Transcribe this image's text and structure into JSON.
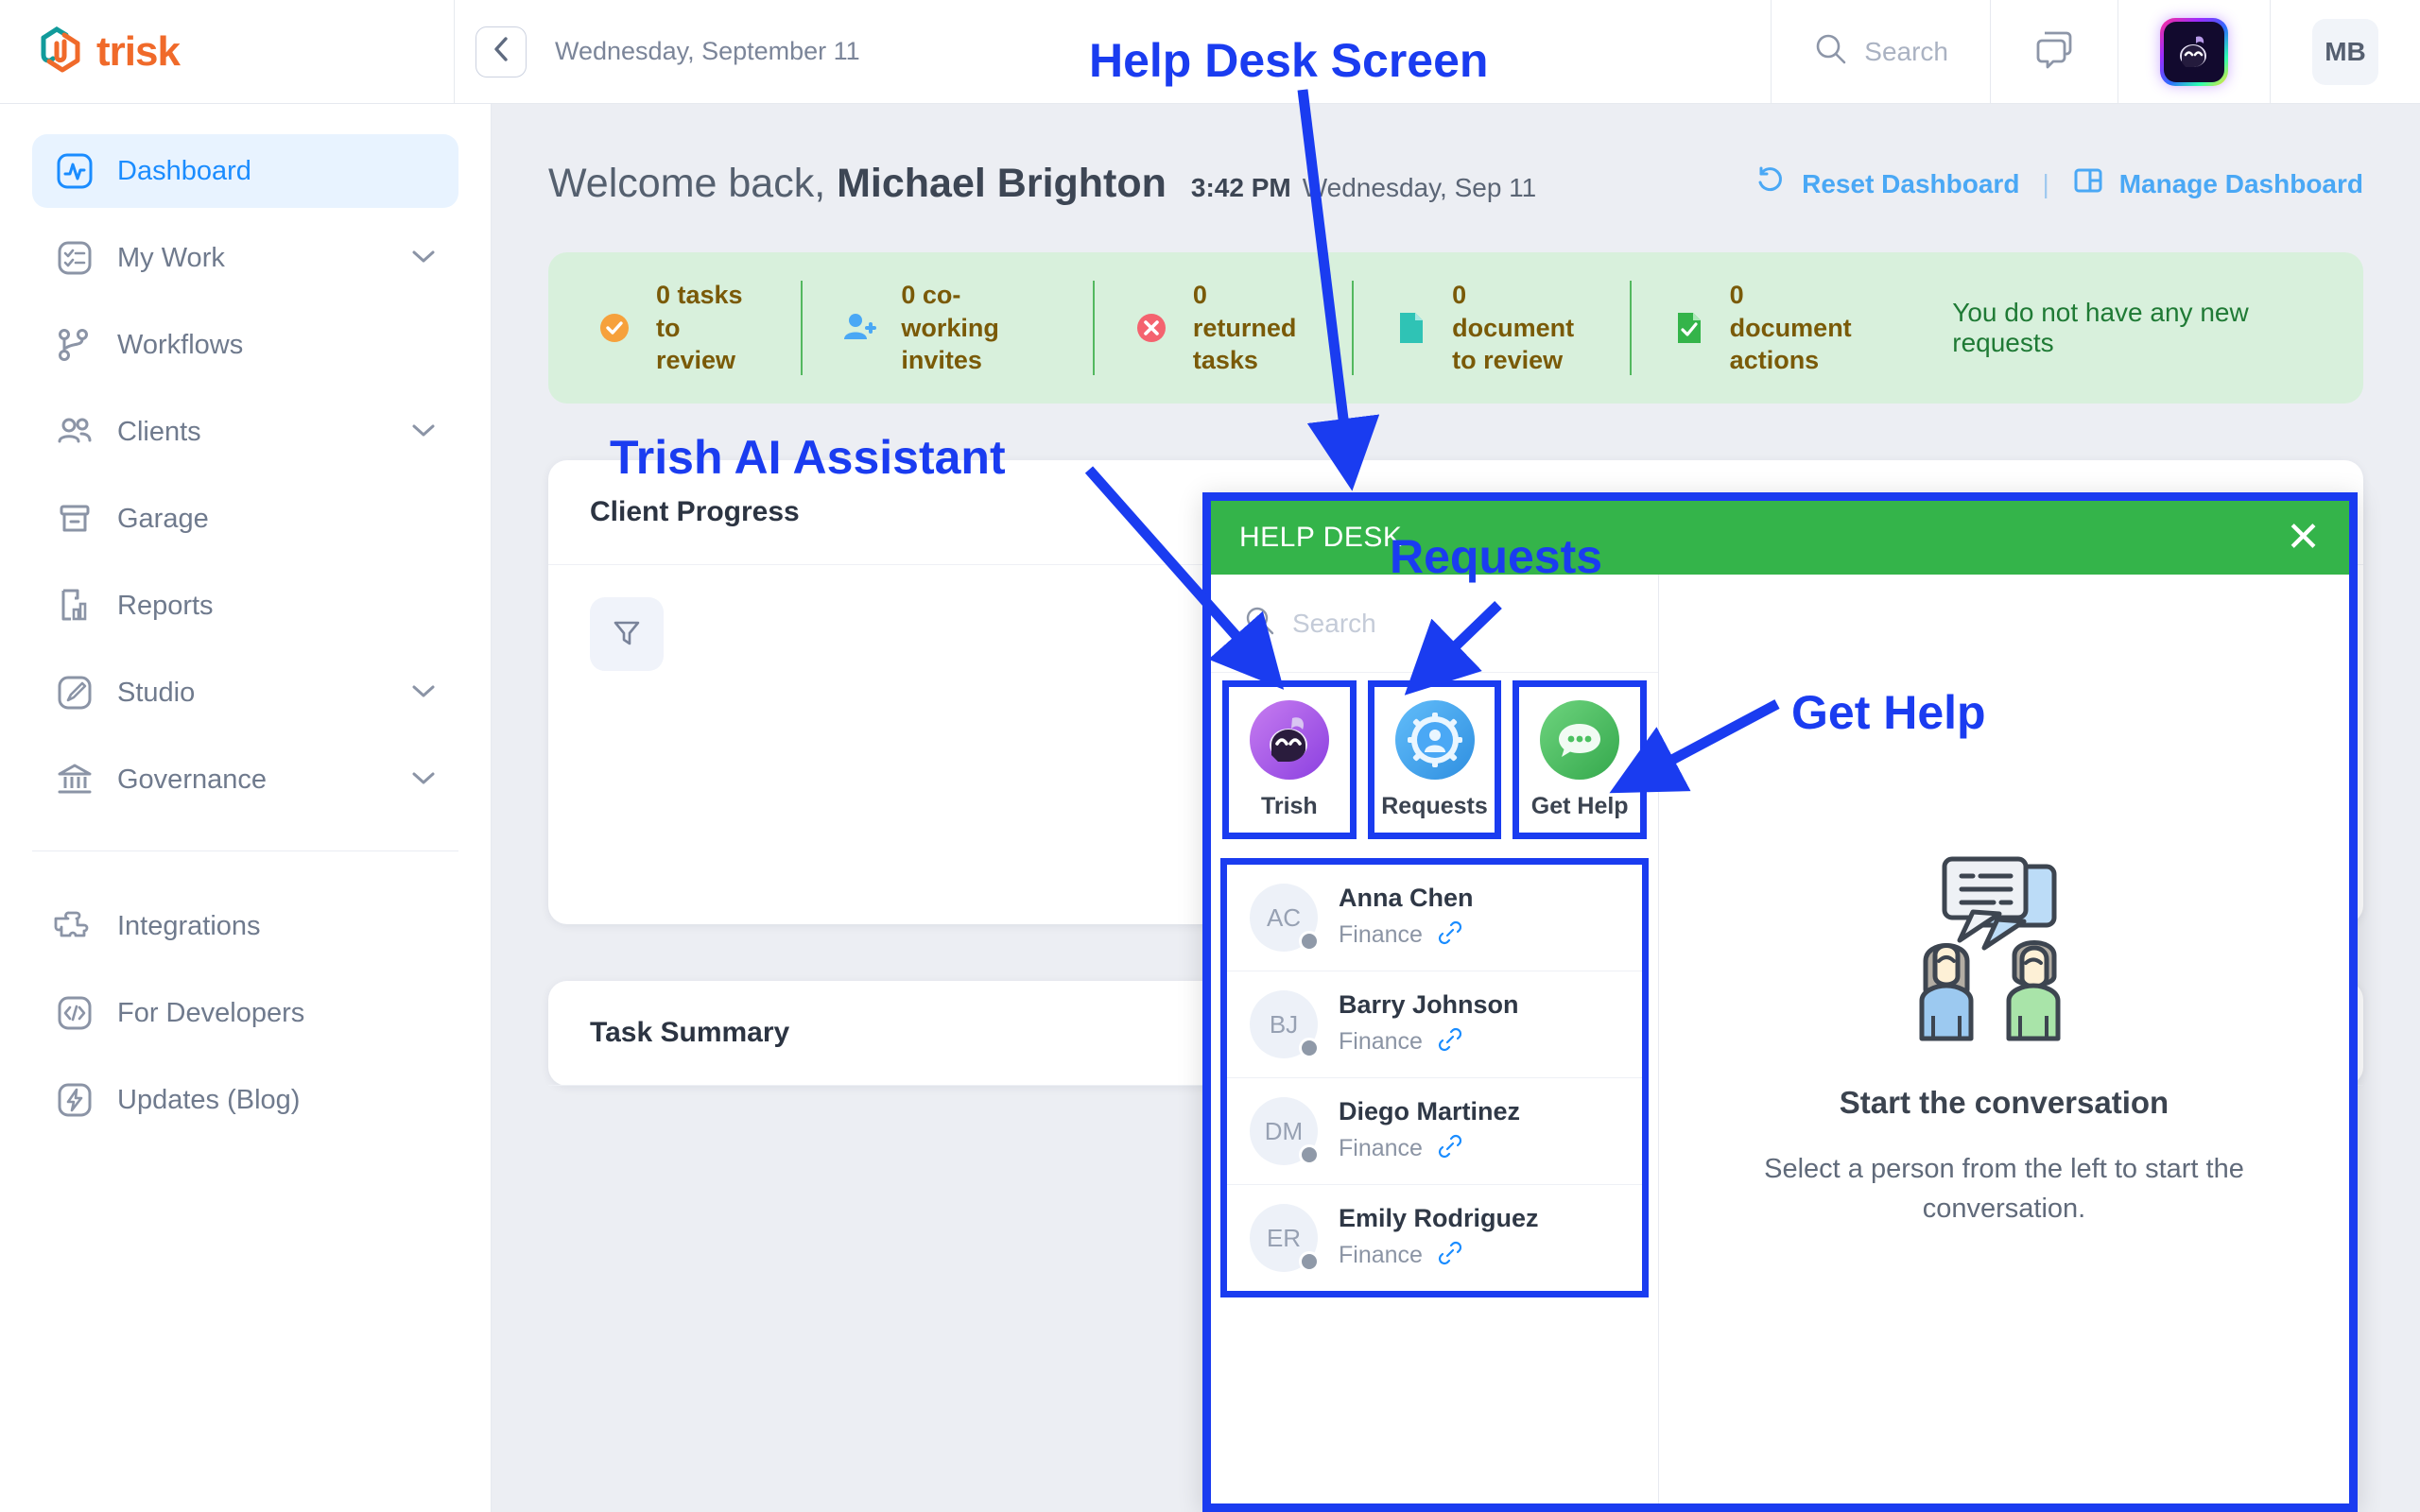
{
  "topbar": {
    "logo_text": "trisk",
    "logo_icon": "hexagon-logo-icon",
    "back_icon": "chevron-left-icon",
    "date": "Wednesday, September 11",
    "search_label": "Search",
    "search_icon": "search-icon",
    "chat_icon": "chat-bubbles-icon",
    "trish_icon": "trish-bot-avatar-icon",
    "user_initials": "MB"
  },
  "sidebar": {
    "items": [
      {
        "label": "Dashboard",
        "icon": "activity-pulse-icon",
        "active": true,
        "expandable": false
      },
      {
        "label": "My Work",
        "icon": "checklist-icon",
        "active": false,
        "expandable": true
      },
      {
        "label": "Workflows",
        "icon": "workflow-branch-icon",
        "active": false,
        "expandable": false
      },
      {
        "label": "Clients",
        "icon": "people-icon",
        "active": false,
        "expandable": true
      },
      {
        "label": "Garage",
        "icon": "garage-box-icon",
        "active": false,
        "expandable": false
      },
      {
        "label": "Reports",
        "icon": "report-chart-icon",
        "active": false,
        "expandable": false
      },
      {
        "label": "Studio",
        "icon": "brush-icon",
        "active": false,
        "expandable": true
      },
      {
        "label": "Governance",
        "icon": "bank-columns-icon",
        "active": false,
        "expandable": true
      }
    ],
    "secondary_items": [
      {
        "label": "Integrations",
        "icon": "puzzle-icon"
      },
      {
        "label": "For Developers",
        "icon": "code-brackets-icon"
      },
      {
        "label": "Updates (Blog)",
        "icon": "lightning-bolt-icon"
      }
    ]
  },
  "dashboard": {
    "welcome_prefix": "Welcome back,",
    "user_name": "Michael Brighton",
    "time": "3:42 PM",
    "date": "Wednesday, Sep 11",
    "reset_label": "Reset Dashboard",
    "reset_icon": "reset-arrow-icon",
    "divider": "|",
    "manage_label": "Manage Dashboard",
    "manage_icon": "dashboard-layout-icon",
    "stats": [
      {
        "count": "0 tasks",
        "line2": "to review",
        "icon": "check-circle-icon",
        "color": "#f6a13c"
      },
      {
        "count": "0 co-working",
        "line2": "invites",
        "icon": "user-plus-icon",
        "color": "#4aa8f5"
      },
      {
        "count": "0 returned",
        "line2": "tasks",
        "icon": "x-circle-icon",
        "color": "#f4636f"
      },
      {
        "count": "0 document",
        "line2": "to review",
        "icon": "document-icon",
        "color": "#2fc3b5"
      },
      {
        "count": "0 document",
        "line2": "actions",
        "icon": "document-check-icon",
        "color": "#34b44a"
      }
    ],
    "stats_note": "You do not have any new requests",
    "cards": [
      {
        "title": "Client Progress",
        "filter_icon": "filter-funnel-icon"
      },
      {
        "title": "Task Summary",
        "filter_icon": "filter-funnel-icon"
      }
    ]
  },
  "helpdesk": {
    "header_title": "HELP DESK",
    "close_icon": "close-x-icon",
    "close_label": "✕",
    "search_placeholder": "Search",
    "search_icon": "search-icon",
    "tiles": [
      {
        "label": "Trish",
        "icon": "trish-bot-icon",
        "color": "#a855e8"
      },
      {
        "label": "Requests",
        "icon": "gear-person-icon",
        "color": "#4aa8f5"
      },
      {
        "label": "Get Help",
        "icon": "chat-dots-icon",
        "color": "#4cc161"
      }
    ],
    "contacts": [
      {
        "initials": "AC",
        "name": "Anna Chen",
        "dept": "Finance",
        "link_icon": "link-chain-icon",
        "status": "offline"
      },
      {
        "initials": "BJ",
        "name": "Barry Johnson",
        "dept": "Finance",
        "link_icon": "link-chain-icon",
        "status": "offline"
      },
      {
        "initials": "DM",
        "name": "Diego Martinez",
        "dept": "Finance",
        "link_icon": "link-chain-icon",
        "status": "offline"
      },
      {
        "initials": "ER",
        "name": "Emily Rodriguez",
        "dept": "Finance",
        "link_icon": "link-chain-icon",
        "status": "offline"
      }
    ],
    "empty_state": {
      "illustration": "two-people-conversation-icon",
      "title": "Start the conversation",
      "subtitle": "Select a person from the left to start the conversation."
    }
  },
  "annotations": {
    "color": "#1a3cf0",
    "labels": [
      {
        "text": "Help Desk Screen",
        "id": "anno-help-desk-screen"
      },
      {
        "text": "Trish AI Assistant",
        "id": "anno-trish-ai-assistant"
      },
      {
        "text": "Requests",
        "id": "anno-requests"
      },
      {
        "text": "Get Help",
        "id": "anno-get-help"
      }
    ]
  }
}
